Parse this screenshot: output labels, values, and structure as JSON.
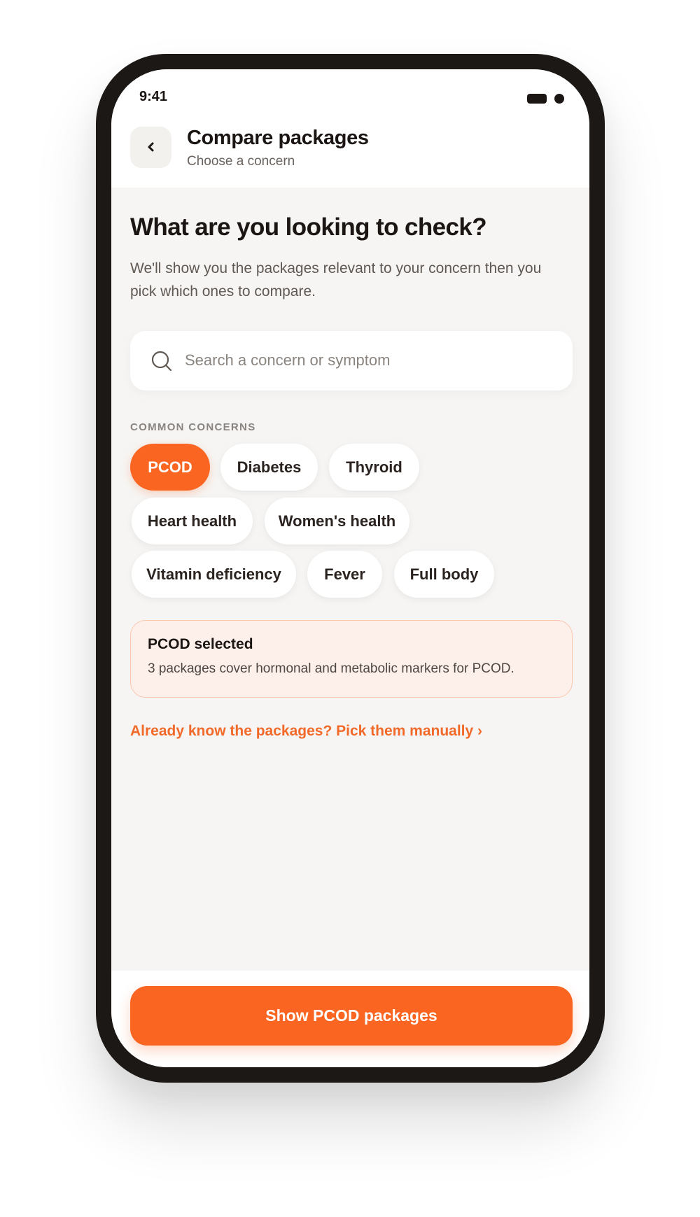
{
  "status_bar": {
    "time": "9:41",
    "battery_icon": "battery-icon",
    "dot_icon": "dot-icon"
  },
  "header": {
    "back_icon": "chevron-left-icon",
    "title": "Compare packages",
    "subtitle": "Choose a concern"
  },
  "main": {
    "heading": "What are you looking to check?",
    "description": "We'll show you the packages relevant to your concern then you pick which ones to compare."
  },
  "search": {
    "placeholder": "Search a concern or symptom",
    "value": "",
    "icon": "search-icon"
  },
  "concerns": {
    "section_label": "COMMON CONCERNS",
    "selected": "PCOD",
    "chips": [
      "PCOD",
      "Diabetes",
      "Thyroid",
      "Heart health",
      "Women's health",
      "Vitamin deficiency",
      "Fever",
      "Full body"
    ]
  },
  "selection_card": {
    "title": "PCOD selected",
    "text": "3 packages cover hormonal and metabolic markers for PCOD."
  },
  "manual_link": "Already know the packages? Pick them manually ›",
  "cta": {
    "label": "Show PCOD packages"
  },
  "colors": {
    "accent": "#fb6522",
    "background": "#f6f5f3",
    "card_tint": "#fdf0ea",
    "text_dark": "#1b1613"
  }
}
